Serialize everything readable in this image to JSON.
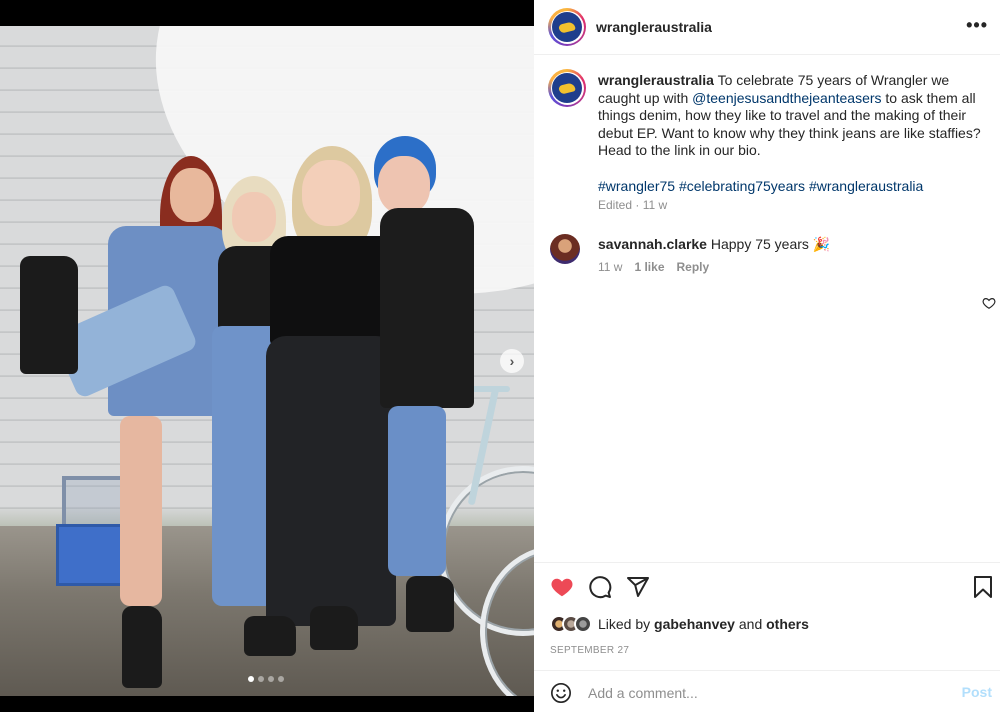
{
  "post": {
    "username": "wrangleraustralia",
    "more_icon": "more-options-icon",
    "media": {
      "current_slide": 1,
      "total_slides": 4
    }
  },
  "caption": {
    "username": "wrangleraustralia",
    "text_before_mention": "To celebrate 75 years of Wrangler we caught up with ",
    "mention": "@teenjesusandthejeanteasers",
    "text_after_mention": " to ask them all things denim, how they like to travel and the making of their debut EP. Want to know why they think jeans are like staffies? Head to the link in our bio.",
    "hashtags": [
      "#wrangler75",
      "#celebrating75years",
      "#wrangleraustralia"
    ],
    "edited": "Edited · 11 w"
  },
  "comment": {
    "username": "savannah.clarke",
    "text": "Happy 75 years 🎉",
    "age": "11 w",
    "likes": "1 like",
    "reply": "Reply"
  },
  "actions": {
    "liked_by_prefix": "Liked by ",
    "liked_by_user": "gabehanvey",
    "liked_by_mid": " and ",
    "liked_by_others": "others",
    "date": "SEPTEMBER 27"
  },
  "comment_box": {
    "placeholder": "Add a comment...",
    "post_label": "Post"
  },
  "colors": {
    "like_red": "#ed4956",
    "link_blue": "#00376b",
    "post_disabled": "#b2dffc"
  }
}
